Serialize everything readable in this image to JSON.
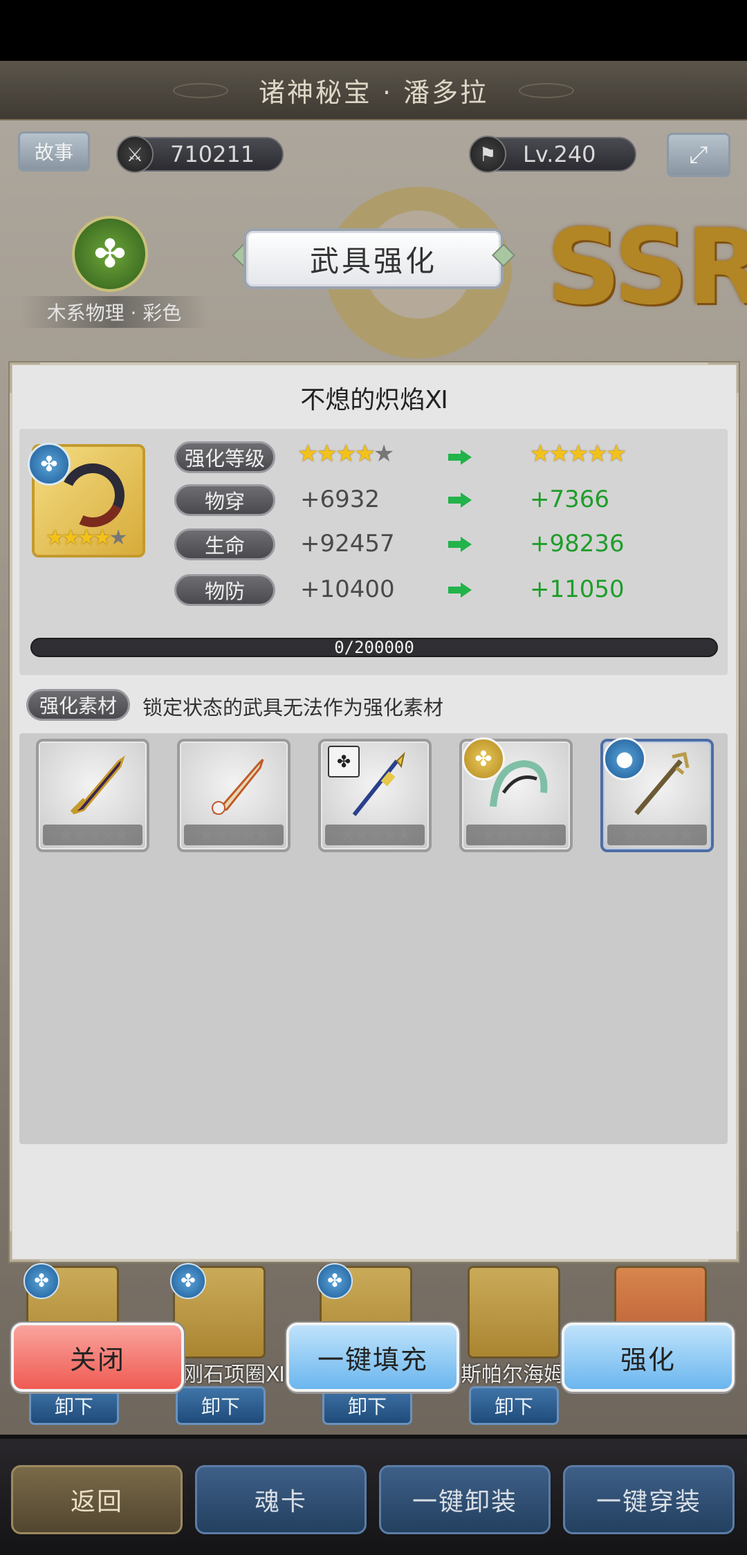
{
  "header": {
    "title": "诸神秘宝 · 潘多拉"
  },
  "top_bar": {
    "story_label": "故事",
    "power_value": "710211",
    "level_value": "Lv.240"
  },
  "character": {
    "element_label": "木系物理 · 彩色",
    "rarity": "SSR"
  },
  "dialog": {
    "title": "武具强化",
    "weapon_name": "不熄的炽焰Ⅺ",
    "weapon_stars": 4,
    "stats": [
      {
        "label": "强化等级",
        "current_stars": 4,
        "next_stars": 5
      },
      {
        "label": "物穿",
        "current": "+6932",
        "next": "+7366"
      },
      {
        "label": "生命",
        "current": "+92457",
        "next": "+98236"
      },
      {
        "label": "物防",
        "current": "+10400",
        "next": "+11050"
      }
    ],
    "progress": {
      "text": "0/200000",
      "fraction": 0
    },
    "materials": {
      "label": "强化素材",
      "hint": "锁定状态的武具无法作为强化素材",
      "items": [
        {
          "icon": "greatsword-icon"
        },
        {
          "icon": "flame-sword-icon"
        },
        {
          "icon": "spear-icon"
        },
        {
          "icon": "jade-bow-icon"
        },
        {
          "icon": "trident-icon"
        }
      ]
    }
  },
  "equipment": {
    "names": [
      "刚石项圈Ⅺ",
      "斯帕尔海姆"
    ],
    "unequip_label": "卸下"
  },
  "actions": {
    "close": "关闭",
    "auto_fill": "一键填充",
    "enhance": "强化"
  },
  "bottom_nav": {
    "back": "返回",
    "soul_card": "魂卡",
    "unequip_all": "一键卸装",
    "equip_all": "一键穿装"
  },
  "colors": {
    "accent_green": "#1f9d2a",
    "star_gold": "#f3c21a",
    "close_red": "#ef5b53",
    "action_blue": "#6bb6ee"
  }
}
